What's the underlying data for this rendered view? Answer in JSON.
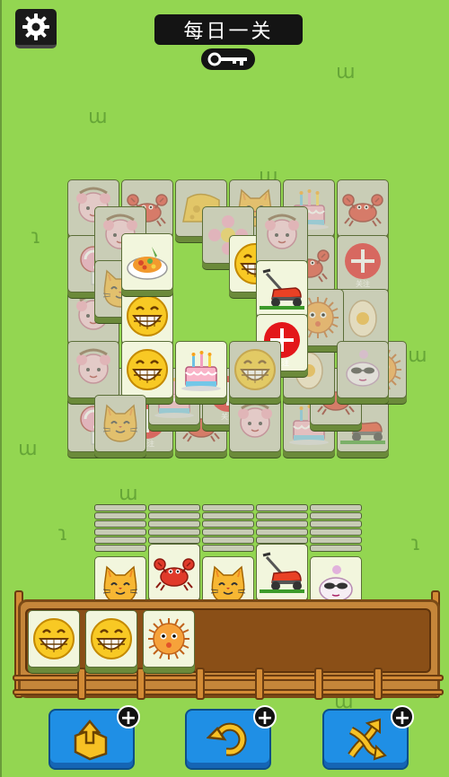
{
  "header": {
    "title": "每日一关",
    "settings_icon": "gear-icon",
    "key_icon": "key-icon"
  },
  "tile_labels": {
    "follow": "关注"
  },
  "board_tiles": [
    "girl",
    "crab",
    "cheese",
    "cat",
    "cake",
    "crab",
    "lollipop",
    "girl",
    "flower",
    "crab",
    "follow",
    "egg",
    "cat",
    "emoji",
    "mower",
    "pufferfish",
    "girl",
    "girl",
    "duck",
    "emoji",
    "food",
    "emoji",
    "mower",
    "follow",
    "emoji",
    "cake",
    "cat"
  ],
  "tray_tiles": [
    "emoji",
    "emoji",
    "pufferfish"
  ],
  "stack_fronts": [
    "cat",
    "crab",
    "cat",
    "mower",
    "duck"
  ],
  "buttons": [
    {
      "name": "shuffle",
      "icon": "move-out-icon"
    },
    {
      "name": "undo",
      "icon": "undo-icon"
    },
    {
      "name": "shuffle",
      "icon": "shuffle-icon"
    }
  ],
  "colors": {
    "background": "#93d651",
    "button": "#1f8fe5",
    "tray": "#c5863a"
  }
}
